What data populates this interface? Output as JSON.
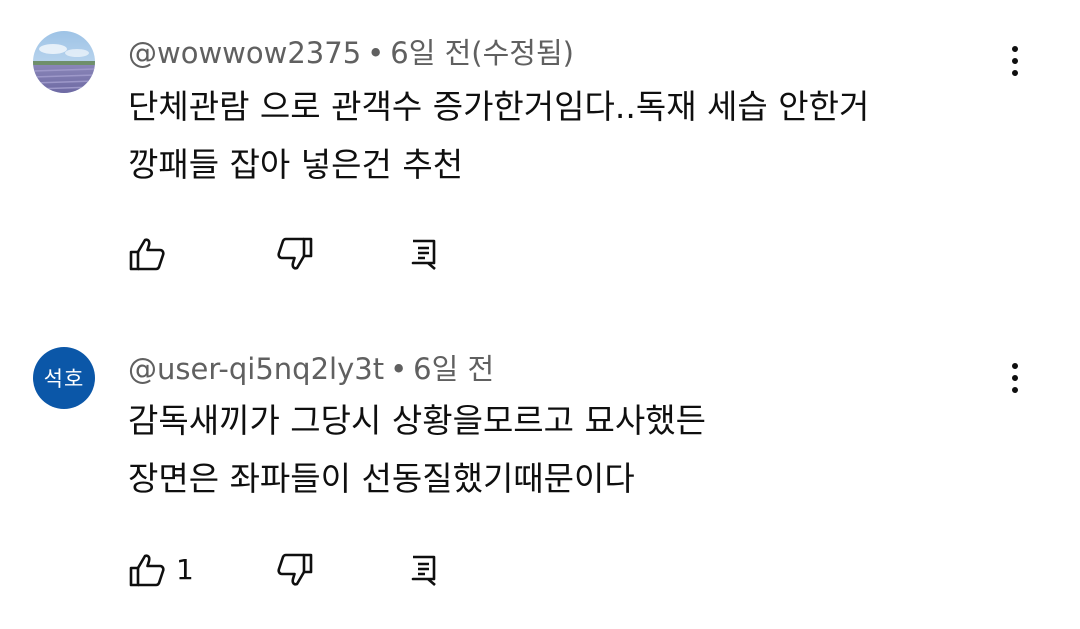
{
  "comments": [
    {
      "avatar": {
        "type": "photo",
        "icon": "lavender-field-photo"
      },
      "author": "@wowwow2375",
      "separator": "•",
      "time": "6일 전(수정됨)",
      "lines": [
        "단체관람 으로 관객수 증가한거임다..독재 세습 안한거",
        "깡패들 잡아 넣은건 추천"
      ],
      "likes": "",
      "icons": {
        "more": "more-vert-icon",
        "like": "thumb-up-icon",
        "dislike": "thumb-down-icon",
        "reply": "reply-icon"
      }
    },
    {
      "avatar": {
        "type": "initials",
        "initials": "석호",
        "color": "#0b57a8"
      },
      "author": "@user-qi5nq2ly3t",
      "separator": "•",
      "time": "6일 전",
      "lines": [
        "감독새끼가 그당시 상황을모르고 묘사했든",
        "장면은 좌파들이 선동질했기때문이다"
      ],
      "likes": "1",
      "icons": {
        "more": "more-vert-icon",
        "like": "thumb-up-icon",
        "dislike": "thumb-down-icon",
        "reply": "reply-icon"
      }
    }
  ]
}
